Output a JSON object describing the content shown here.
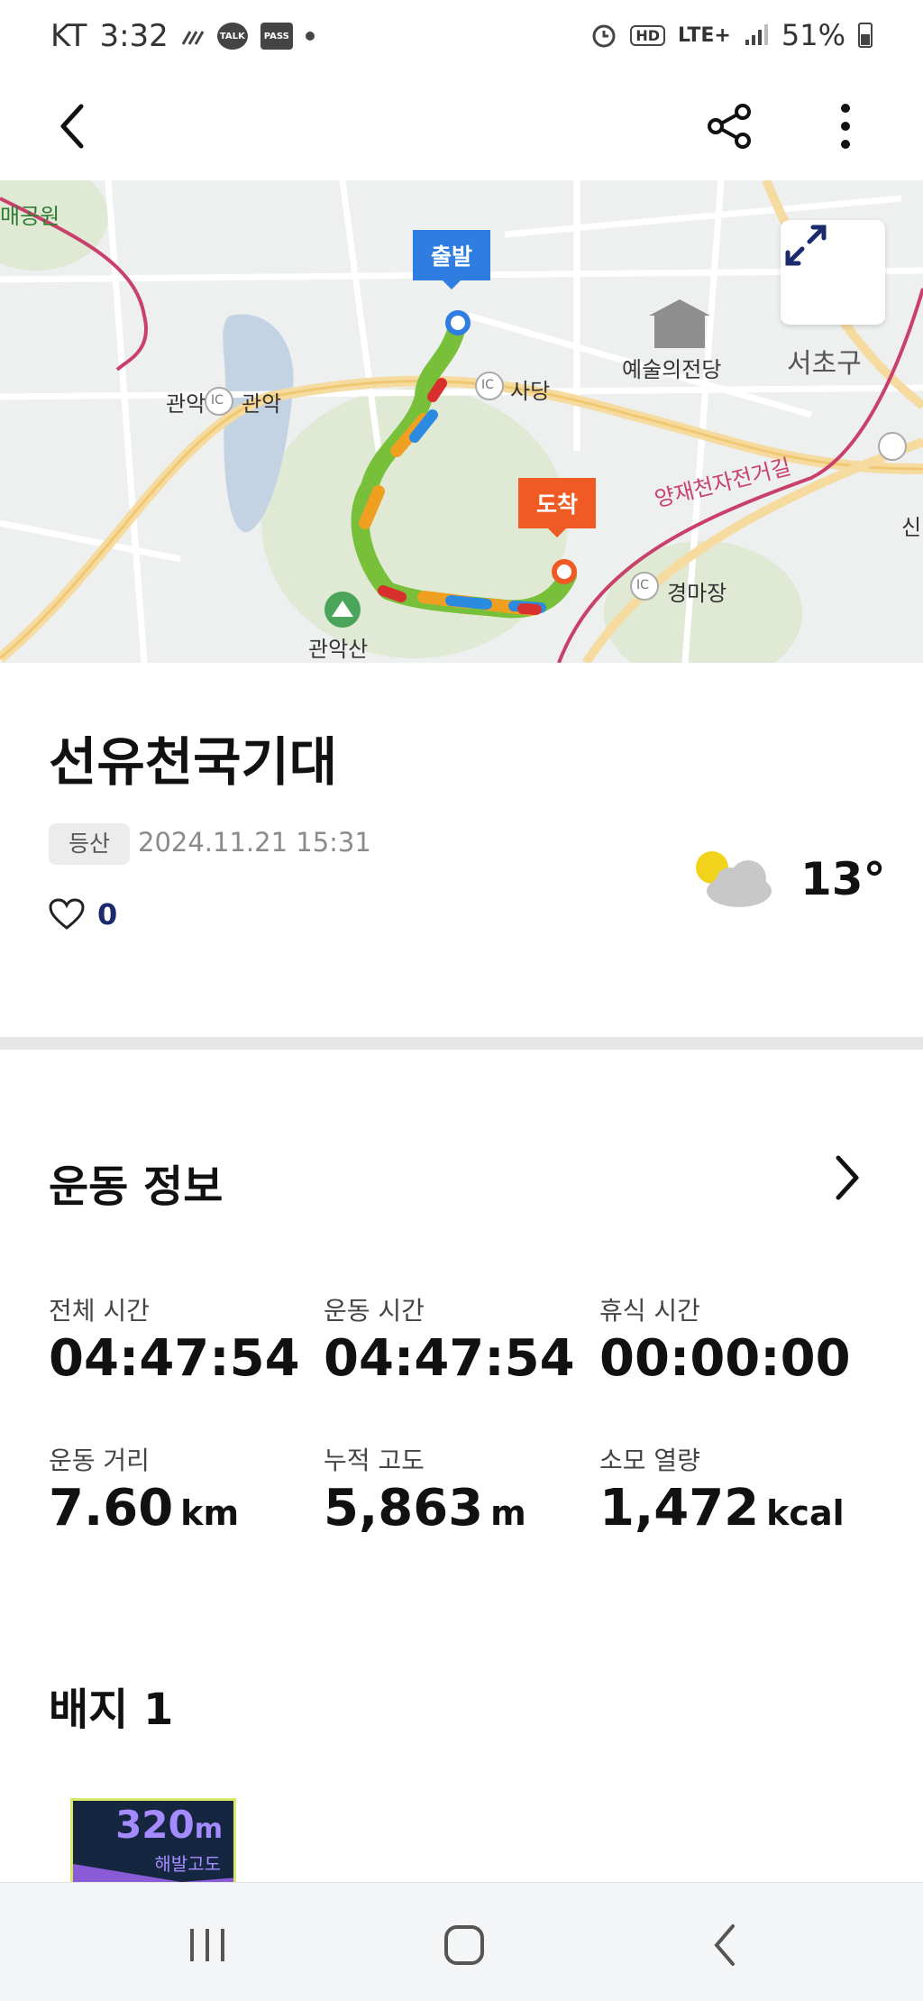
{
  "status_bar": {
    "carrier": "KT",
    "time": "3:32",
    "talk": "TALK",
    "pass": "PASS",
    "hd": "HD",
    "network": "LTE+",
    "battery": "51%"
  },
  "map": {
    "start_label": "출발",
    "end_label": "도착",
    "place_labels": [
      "매공원",
      "관악",
      "관악",
      "사당",
      "예술의전당",
      "서초구",
      "양재천자전거길",
      "경마장",
      "관악산",
      "신"
    ],
    "ic_label": "IC"
  },
  "record": {
    "title": "선유천국기대",
    "tag": "등산",
    "datetime": "2024.11.21 15:31",
    "likes": "0",
    "weather_icon": "partly-cloudy-icon",
    "temperature": "13°"
  },
  "exercise": {
    "section_title": "운동 정보",
    "stats": [
      {
        "label": "전체 시간",
        "value": "04:47:54",
        "unit": ""
      },
      {
        "label": "운동 시간",
        "value": "04:47:54",
        "unit": ""
      },
      {
        "label": "휴식 시간",
        "value": "00:00:00",
        "unit": ""
      },
      {
        "label": "운동 거리",
        "value": "7.60",
        "unit": "km"
      },
      {
        "label": "누적 고도",
        "value": "5,863",
        "unit": "m"
      },
      {
        "label": "소모 열량",
        "value": "1,472",
        "unit": "kcal"
      }
    ]
  },
  "badges": {
    "section_title": "배지 1",
    "items": [
      {
        "value": "320",
        "unit": "m",
        "caption": "해발고도"
      }
    ]
  },
  "colors": {
    "start_pin": "#2f7de1",
    "end_pin": "#ef5a25",
    "likes": "#1a2a6c"
  }
}
